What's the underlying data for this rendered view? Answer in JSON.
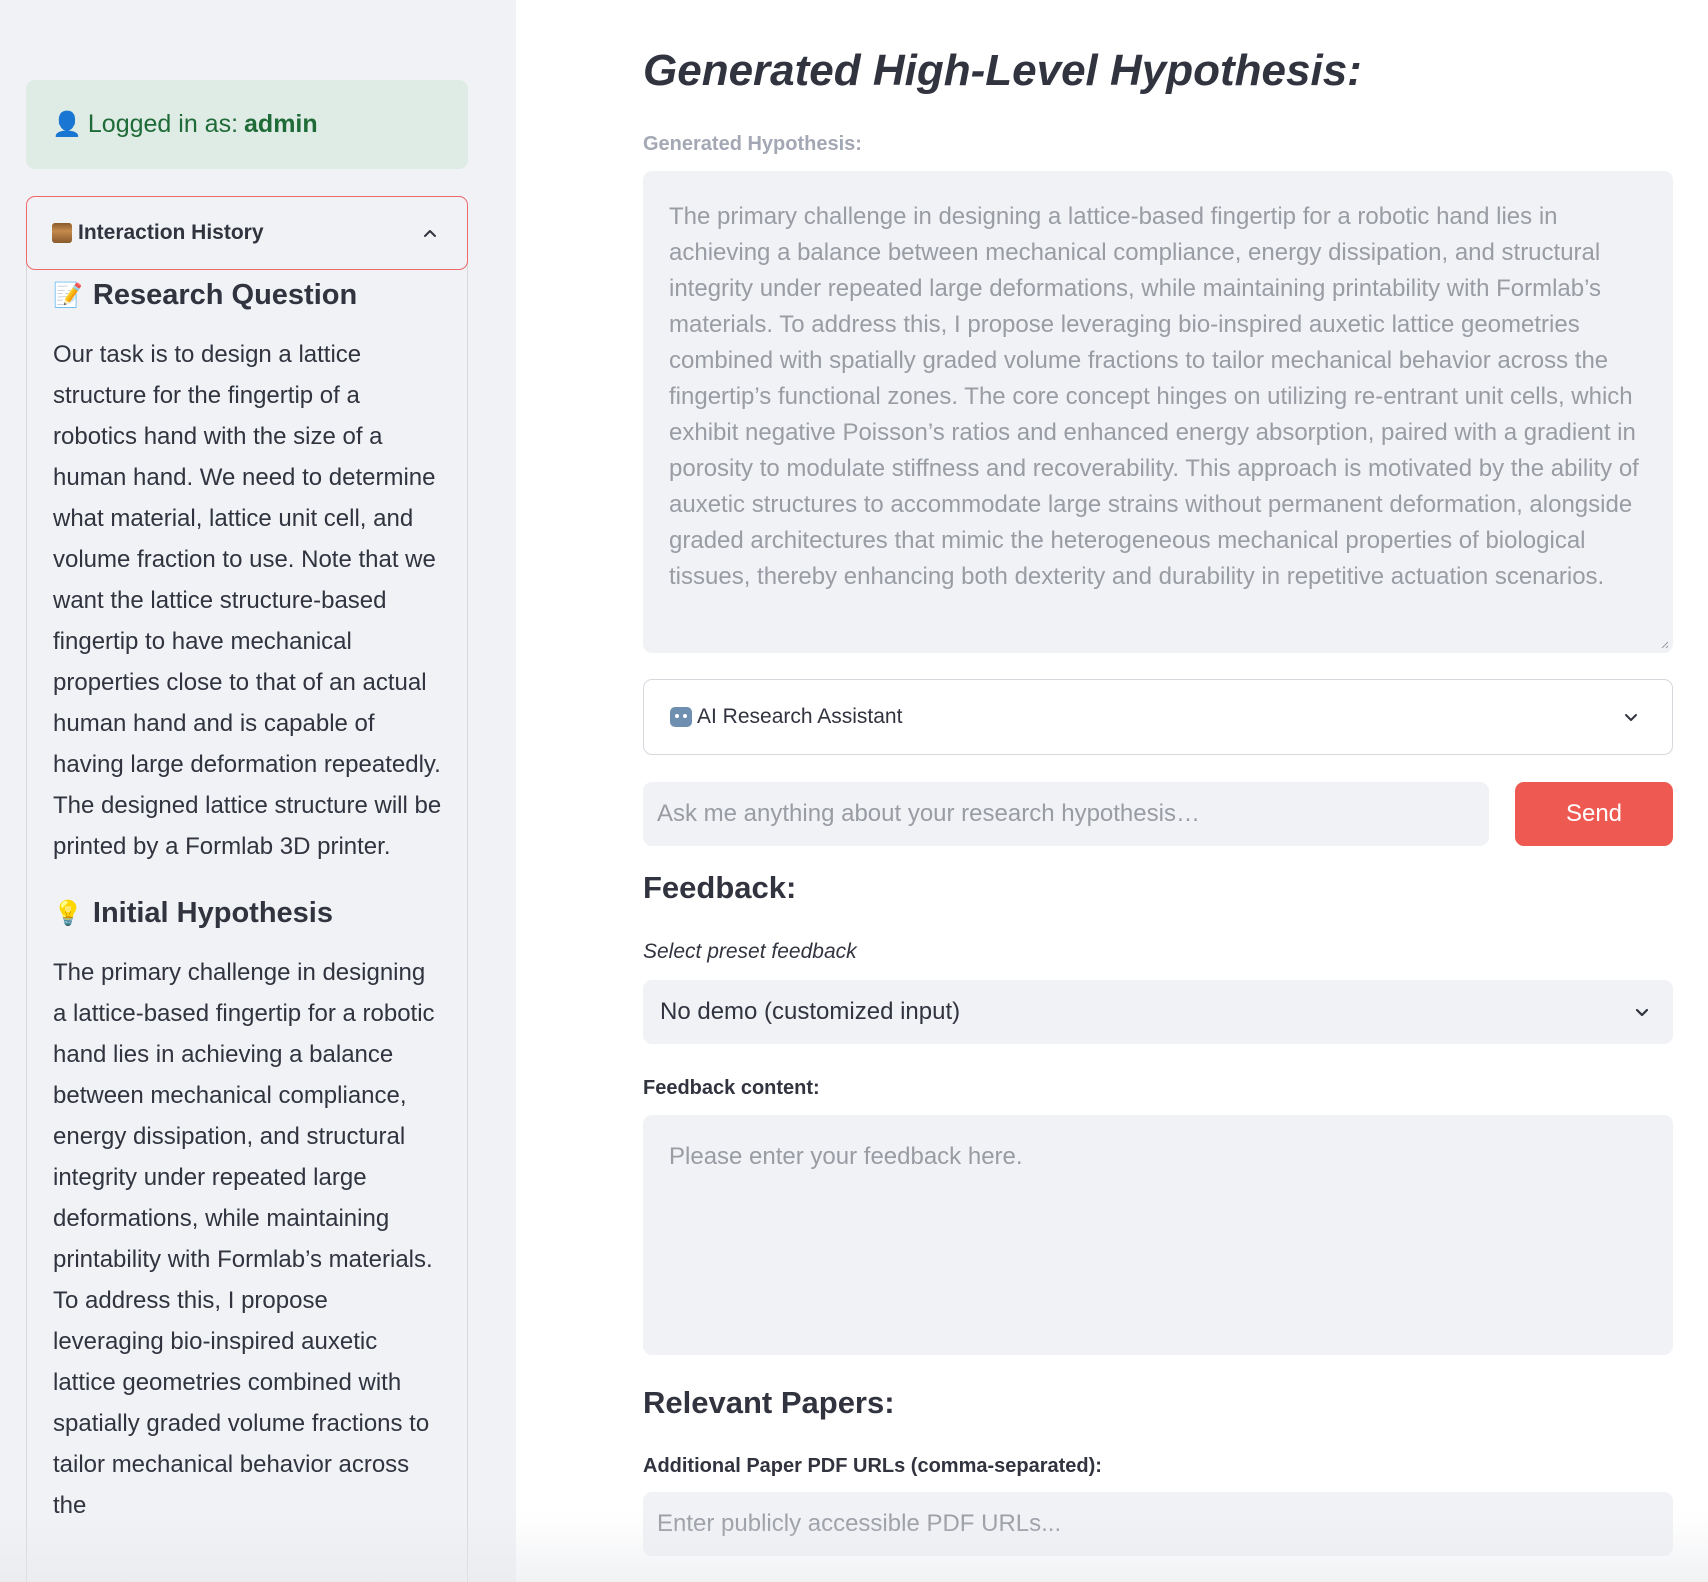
{
  "sidebar": {
    "login": {
      "prefix": "Logged in as:",
      "username": "admin"
    },
    "history": {
      "title": "Interaction History",
      "research_question": {
        "title": "Research Question",
        "text": "Our task is to design a lattice structure for the fingertip of a robotics hand with the size of a human hand. We need to determine what material, lattice unit cell, and volume fraction to use. Note that we want the lattice structure-based fingertip to have mechanical properties close to that of an actual human hand and is capable of having large deformation repeatedly. The designed lattice structure will be printed by a Formlab 3D printer."
      },
      "initial_hypothesis": {
        "title": "Initial Hypothesis",
        "text": "The primary challenge in designing a lattice-based fingertip for a robotic hand lies in achieving a balance between mechanical compliance, energy dissipation, and structural integrity under repeated large deformations, while maintaining printability with Formlab’s materials. To address this, I propose leveraging bio-inspired auxetic lattice geometries combined with spatially graded volume fractions to tailor mechanical behavior across the"
      }
    }
  },
  "main": {
    "title": "Generated High-Level Hypothesis:",
    "generated_label": "Generated Hypothesis:",
    "generated_text": "The primary challenge in designing a lattice-based fingertip for a robotic hand lies in achieving a balance between mechanical compliance, energy dissipation, and structural integrity under repeated large deformations, while maintaining printability with Formlab’s materials. To address this, I propose leveraging bio-inspired auxetic lattice geometries combined with spatially graded volume fractions to tailor mechanical behavior across the fingertip’s functional zones. The core concept hinges on utilizing re-entrant unit cells, which exhibit negative Poisson’s ratios and enhanced energy absorption, paired with a gradient in porosity to modulate stiffness and recoverability. This approach is motivated by the ability of auxetic structures to accommodate large strains without permanent deformation, alongside graded architectures that mimic the heterogeneous mechanical properties of biological tissues, thereby enhancing both dexterity and durability in repetitive actuation scenarios.",
    "assistant": {
      "label": "AI Research Assistant",
      "input_placeholder": "Ask me anything about your research hypothesis…",
      "send_label": "Send"
    },
    "feedback": {
      "heading": "Feedback:",
      "preset_label": "Select preset feedback",
      "preset_value": "No demo (customized input)",
      "content_label": "Feedback content:",
      "content_placeholder": "Please enter your feedback here."
    },
    "papers": {
      "heading": "Relevant Papers:",
      "urls_label": "Additional Paper PDF URLs (comma-separated):",
      "urls_placeholder": "Enter publicly accessible PDF URLs..."
    }
  },
  "colors": {
    "accent": "#ee5a52",
    "sidebar_bg": "#f0f2f6",
    "login_bg": "#dfebe5",
    "login_text": "#1e6b37"
  },
  "icons": {
    "user": "user-icon",
    "scroll": "scroll-icon",
    "memo": "memo-icon",
    "bulb": "lightbulb-icon",
    "robot": "robot-icon"
  }
}
